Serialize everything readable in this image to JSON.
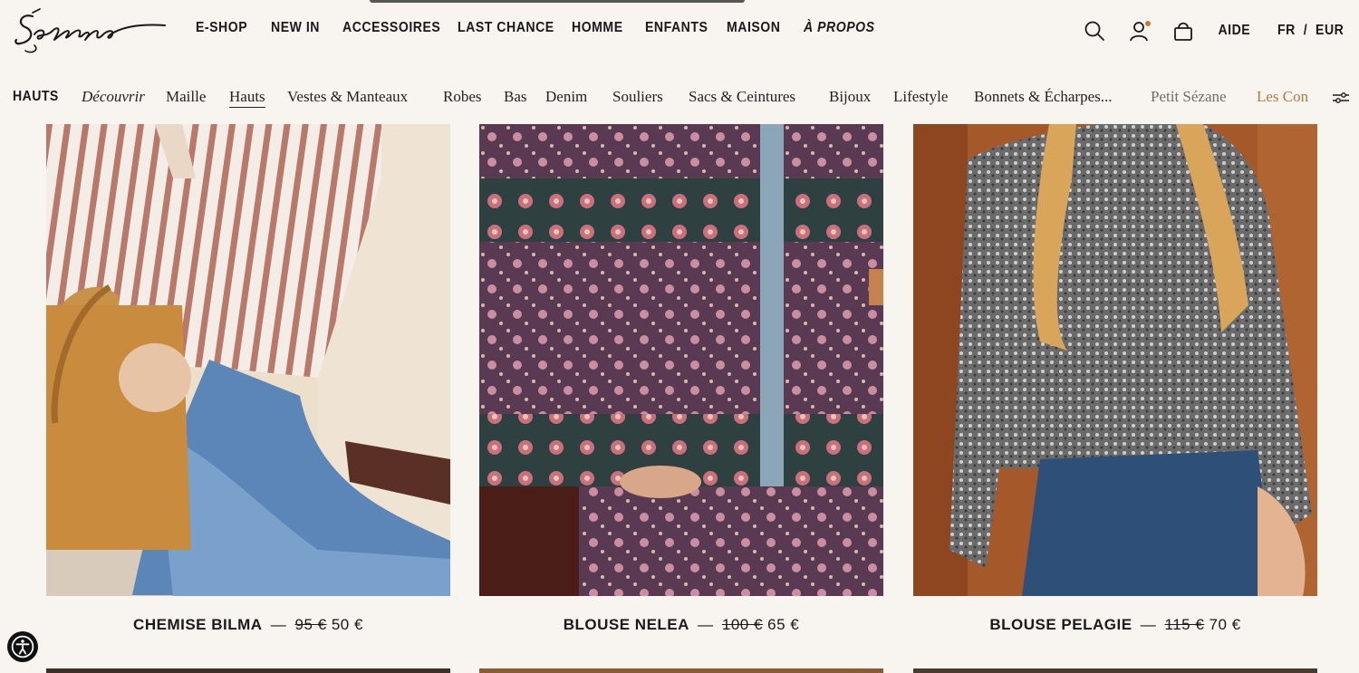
{
  "brand": {
    "logo_text": "Sézane"
  },
  "main_nav": [
    {
      "label": "E-SHOP"
    },
    {
      "label": "NEW IN"
    },
    {
      "label": "ACCESSOIRES"
    },
    {
      "label": "LAST CHANCE"
    },
    {
      "label": "HOMME"
    },
    {
      "label": "ENFANTS"
    },
    {
      "label": "MAISON"
    },
    {
      "label": "À PROPOS"
    }
  ],
  "tools": {
    "search_icon": "search-icon",
    "account_icon": "user-icon",
    "bag_icon": "shopping-bag-icon",
    "help_label": "AIDE",
    "locale_label": "FR  /  EUR"
  },
  "sub_nav": {
    "title": "HAUTS",
    "items": [
      {
        "label": "Découvrir"
      },
      {
        "label": "Maille"
      },
      {
        "label": "Hauts"
      },
      {
        "label": "Vestes & Manteaux"
      },
      {
        "label": "Robes"
      },
      {
        "label": "Bas"
      },
      {
        "label": "Denim"
      },
      {
        "label": "Souliers"
      },
      {
        "label": "Sacs & Ceintures"
      },
      {
        "label": "Bijoux"
      },
      {
        "label": "Lifestyle"
      },
      {
        "label": "Bonnets & Écharpes..."
      },
      {
        "label": "Petit Sézane"
      },
      {
        "label": "Les Con"
      }
    ],
    "active": "Hauts",
    "accent_color": "#b07a44"
  },
  "products": [
    {
      "name": "CHEMISE BILMA",
      "separator": "—",
      "old_price": "95 €",
      "price": "50 €"
    },
    {
      "name": "BLOUSE NELEA",
      "separator": "—",
      "old_price": "100 €",
      "price": "65 €"
    },
    {
      "name": "BLOUSE PELAGIE",
      "separator": "—",
      "old_price": "115 €",
      "price": "70 €"
    }
  ],
  "colors": {
    "background": "#f8f4ef",
    "text": "#1a1a1a",
    "badge": "#c07a3c"
  }
}
